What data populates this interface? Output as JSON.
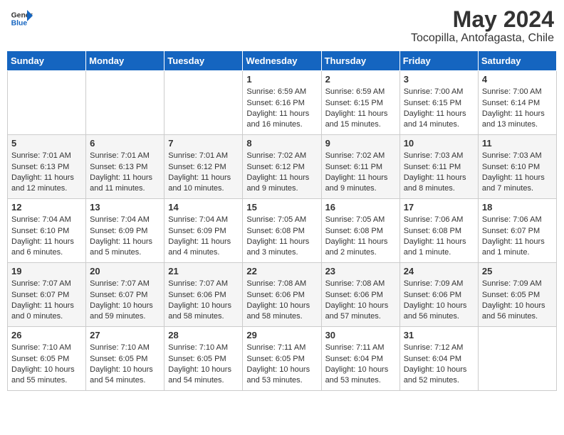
{
  "header": {
    "logo_general": "General",
    "logo_blue": "Blue",
    "month_title": "May 2024",
    "location": "Tocopilla, Antofagasta, Chile"
  },
  "days_of_week": [
    "Sunday",
    "Monday",
    "Tuesday",
    "Wednesday",
    "Thursday",
    "Friday",
    "Saturday"
  ],
  "weeks": [
    [
      {
        "day": "",
        "info": ""
      },
      {
        "day": "",
        "info": ""
      },
      {
        "day": "",
        "info": ""
      },
      {
        "day": "1",
        "info": "Sunrise: 6:59 AM\nSunset: 6:16 PM\nDaylight: 11 hours and 16 minutes."
      },
      {
        "day": "2",
        "info": "Sunrise: 6:59 AM\nSunset: 6:15 PM\nDaylight: 11 hours and 15 minutes."
      },
      {
        "day": "3",
        "info": "Sunrise: 7:00 AM\nSunset: 6:15 PM\nDaylight: 11 hours and 14 minutes."
      },
      {
        "day": "4",
        "info": "Sunrise: 7:00 AM\nSunset: 6:14 PM\nDaylight: 11 hours and 13 minutes."
      }
    ],
    [
      {
        "day": "5",
        "info": "Sunrise: 7:01 AM\nSunset: 6:13 PM\nDaylight: 11 hours and 12 minutes."
      },
      {
        "day": "6",
        "info": "Sunrise: 7:01 AM\nSunset: 6:13 PM\nDaylight: 11 hours and 11 minutes."
      },
      {
        "day": "7",
        "info": "Sunrise: 7:01 AM\nSunset: 6:12 PM\nDaylight: 11 hours and 10 minutes."
      },
      {
        "day": "8",
        "info": "Sunrise: 7:02 AM\nSunset: 6:12 PM\nDaylight: 11 hours and 9 minutes."
      },
      {
        "day": "9",
        "info": "Sunrise: 7:02 AM\nSunset: 6:11 PM\nDaylight: 11 hours and 9 minutes."
      },
      {
        "day": "10",
        "info": "Sunrise: 7:03 AM\nSunset: 6:11 PM\nDaylight: 11 hours and 8 minutes."
      },
      {
        "day": "11",
        "info": "Sunrise: 7:03 AM\nSunset: 6:10 PM\nDaylight: 11 hours and 7 minutes."
      }
    ],
    [
      {
        "day": "12",
        "info": "Sunrise: 7:04 AM\nSunset: 6:10 PM\nDaylight: 11 hours and 6 minutes."
      },
      {
        "day": "13",
        "info": "Sunrise: 7:04 AM\nSunset: 6:09 PM\nDaylight: 11 hours and 5 minutes."
      },
      {
        "day": "14",
        "info": "Sunrise: 7:04 AM\nSunset: 6:09 PM\nDaylight: 11 hours and 4 minutes."
      },
      {
        "day": "15",
        "info": "Sunrise: 7:05 AM\nSunset: 6:08 PM\nDaylight: 11 hours and 3 minutes."
      },
      {
        "day": "16",
        "info": "Sunrise: 7:05 AM\nSunset: 6:08 PM\nDaylight: 11 hours and 2 minutes."
      },
      {
        "day": "17",
        "info": "Sunrise: 7:06 AM\nSunset: 6:08 PM\nDaylight: 11 hours and 1 minute."
      },
      {
        "day": "18",
        "info": "Sunrise: 7:06 AM\nSunset: 6:07 PM\nDaylight: 11 hours and 1 minute."
      }
    ],
    [
      {
        "day": "19",
        "info": "Sunrise: 7:07 AM\nSunset: 6:07 PM\nDaylight: 11 hours and 0 minutes."
      },
      {
        "day": "20",
        "info": "Sunrise: 7:07 AM\nSunset: 6:07 PM\nDaylight: 10 hours and 59 minutes."
      },
      {
        "day": "21",
        "info": "Sunrise: 7:07 AM\nSunset: 6:06 PM\nDaylight: 10 hours and 58 minutes."
      },
      {
        "day": "22",
        "info": "Sunrise: 7:08 AM\nSunset: 6:06 PM\nDaylight: 10 hours and 58 minutes."
      },
      {
        "day": "23",
        "info": "Sunrise: 7:08 AM\nSunset: 6:06 PM\nDaylight: 10 hours and 57 minutes."
      },
      {
        "day": "24",
        "info": "Sunrise: 7:09 AM\nSunset: 6:06 PM\nDaylight: 10 hours and 56 minutes."
      },
      {
        "day": "25",
        "info": "Sunrise: 7:09 AM\nSunset: 6:05 PM\nDaylight: 10 hours and 56 minutes."
      }
    ],
    [
      {
        "day": "26",
        "info": "Sunrise: 7:10 AM\nSunset: 6:05 PM\nDaylight: 10 hours and 55 minutes."
      },
      {
        "day": "27",
        "info": "Sunrise: 7:10 AM\nSunset: 6:05 PM\nDaylight: 10 hours and 54 minutes."
      },
      {
        "day": "28",
        "info": "Sunrise: 7:10 AM\nSunset: 6:05 PM\nDaylight: 10 hours and 54 minutes."
      },
      {
        "day": "29",
        "info": "Sunrise: 7:11 AM\nSunset: 6:05 PM\nDaylight: 10 hours and 53 minutes."
      },
      {
        "day": "30",
        "info": "Sunrise: 7:11 AM\nSunset: 6:04 PM\nDaylight: 10 hours and 53 minutes."
      },
      {
        "day": "31",
        "info": "Sunrise: 7:12 AM\nSunset: 6:04 PM\nDaylight: 10 hours and 52 minutes."
      },
      {
        "day": "",
        "info": ""
      }
    ]
  ]
}
